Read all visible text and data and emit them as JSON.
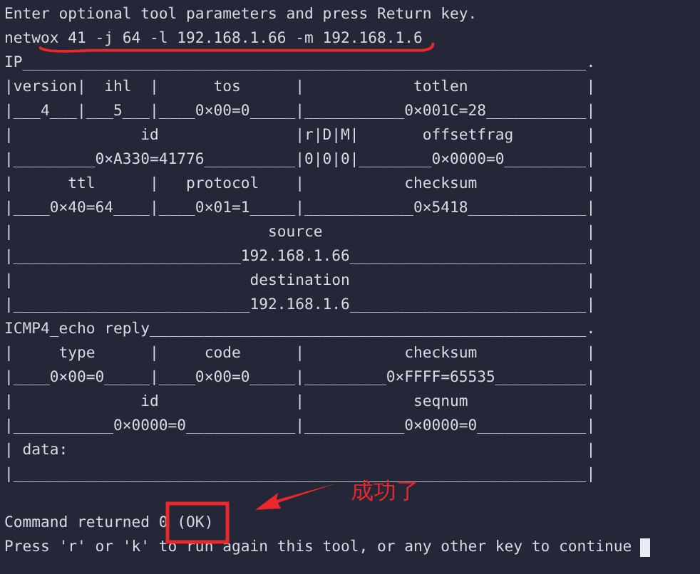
{
  "terminal": {
    "lines": [
      "Enter optional tool parameters and press Return key.",
      "netwox 41 -j 64 -l 192.168.1.66 -m 192.168.1.6",
      "IP______________________________________________________________.",
      "|version|  ihl  |      tos      |            totlen             |",
      "|___4___|___5___|____0×00=0_____|___________0×001C=28___________|",
      "|              id               |r|D|M|       offsetfrag        |",
      "|_________0×A330=41776__________|0|0|0|________0×0000=0_________|",
      "|      ttl      |   protocol    |           checksum            |",
      "|____0×40=64____|____0×01=1_____|____________0×5418_____________|",
      "|                            source                             |",
      "|_________________________192.168.1.66__________________________|",
      "|                          destination                          |",
      "|__________________________192.168.1.6__________________________|",
      "ICMP4_echo reply________________________________________________.",
      "|     type      |     code      |           checksum            |",
      "|____0×00=0_____|____0×00=0_____|_________0×FFFF=65535__________|",
      "|              id               |            seqnum             |",
      "|___________0×0000=0____________|___________0×0000=0____________|",
      "| data:                                                         |",
      "|_______________________________________________________________|"
    ],
    "status_lines": [
      "Command returned 0 (OK)",
      "Press 'r' or 'k' to run again this tool, or any other key to continue"
    ],
    "cursor": true
  },
  "annotation": {
    "label": "成功了"
  }
}
